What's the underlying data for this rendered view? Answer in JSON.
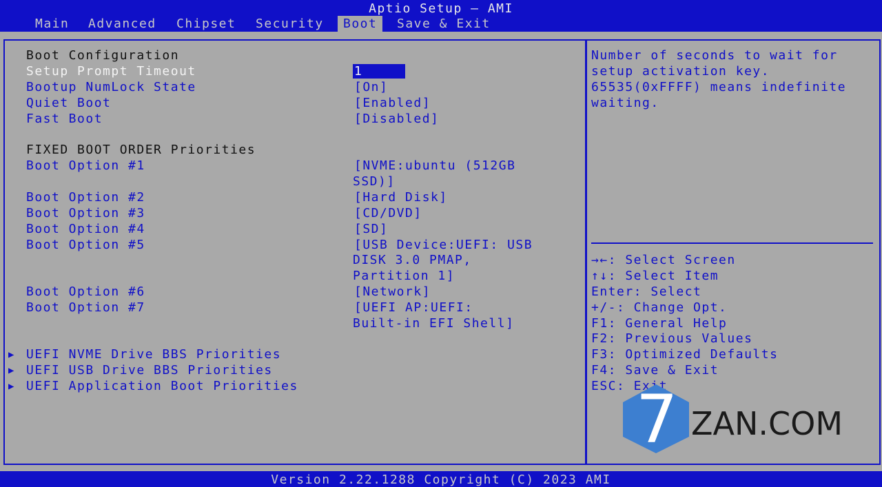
{
  "app": {
    "title": "Aptio Setup – AMI",
    "version": "Version 2.22.1288 Copyright (C) 2023 AMI"
  },
  "tabs": [
    {
      "label": "Main",
      "active": false
    },
    {
      "label": "Advanced",
      "active": false
    },
    {
      "label": "Chipset",
      "active": false
    },
    {
      "label": "Security",
      "active": false
    },
    {
      "label": "Boot",
      "active": true
    },
    {
      "label": "Save & Exit",
      "active": false
    }
  ],
  "main": {
    "boot_config_heading": "Boot Configuration",
    "items": [
      {
        "label": "Setup Prompt Timeout",
        "value": "1"
      },
      {
        "label": "Bootup NumLock State",
        "value": "[On]"
      },
      {
        "label": "Quiet Boot",
        "value": "[Enabled]"
      },
      {
        "label": "Fast Boot",
        "value": "[Disabled]"
      }
    ],
    "fixed_order_heading": "FIXED BOOT ORDER Priorities",
    "boot_options": [
      {
        "label": "Boot Option #1",
        "value_lines": [
          "[NVME:ubuntu (512GB",
          "SSD)]"
        ]
      },
      {
        "label": "Boot Option #2",
        "value_lines": [
          "[Hard Disk]"
        ]
      },
      {
        "label": "Boot Option #3",
        "value_lines": [
          "[CD/DVD]"
        ]
      },
      {
        "label": "Boot Option #4",
        "value_lines": [
          "[SD]"
        ]
      },
      {
        "label": "Boot Option #5",
        "value_lines": [
          "[USB Device:UEFI:  USB",
          "DISK 3.0 PMAP,",
          "Partition 1]"
        ]
      },
      {
        "label": "Boot Option #6",
        "value_lines": [
          "[Network]"
        ]
      },
      {
        "label": "Boot Option #7",
        "value_lines": [
          "[UEFI AP:UEFI:",
          "Built-in EFI Shell]"
        ]
      }
    ],
    "submenus": [
      {
        "label": "UEFI NVME Drive BBS Priorities"
      },
      {
        "label": "UEFI USB Drive BBS Priorities"
      },
      {
        "label": "UEFI Application Boot Priorities"
      }
    ],
    "submenu_arrow": "▶"
  },
  "help": {
    "lines": [
      "Number of seconds to wait for",
      "setup activation key.",
      "65535(0xFFFF) means indefinite",
      "waiting."
    ],
    "keys": [
      "→←: Select Screen",
      "↑↓: Select Item",
      "Enter: Select",
      "+/-: Change Opt.",
      "F1: General Help",
      "F2: Previous Values",
      "F3: Optimized Defaults",
      "F4: Save & Exit",
      "ESC: Exit"
    ]
  },
  "watermark": {
    "text": "ZAN.COM",
    "logo_digit": "7",
    "logo_color": "#3d7fd0"
  }
}
